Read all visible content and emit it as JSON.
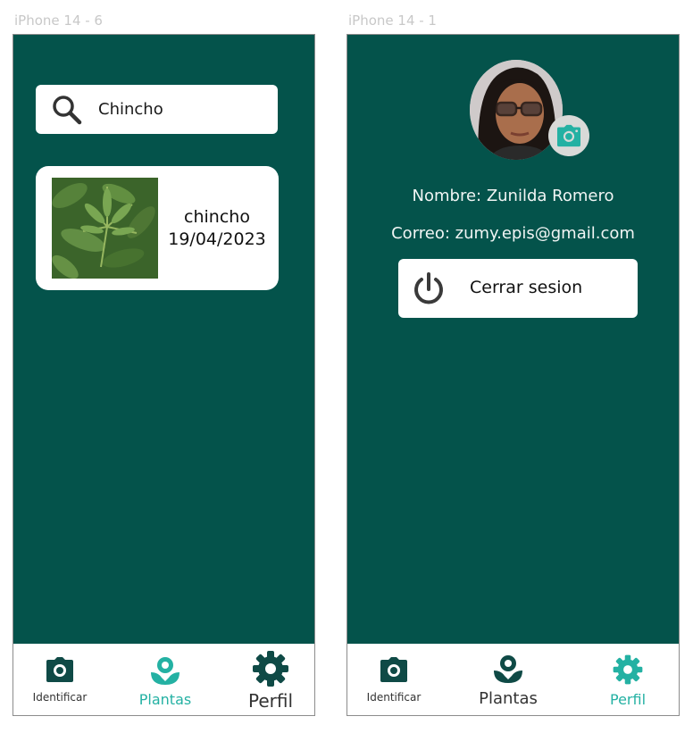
{
  "frames": [
    {
      "label": "iPhone 14 - 6"
    },
    {
      "label": "iPhone 14 - 1"
    }
  ],
  "search": {
    "value": "Chincho"
  },
  "plant_card": {
    "name": "chincho",
    "date": "19/04/2023"
  },
  "profile": {
    "name_line": "Nombre: Zunilda Romero",
    "email_line": "Correo: zumy.epis@gmail.com",
    "logout_label": "Cerrar sesion"
  },
  "nav_left": {
    "identify": "Identificar",
    "plants": "Plantas",
    "profile": "Perfil"
  },
  "nav_right": {
    "identify": "Identificar",
    "plants": "Plantas",
    "profile": "Perfil"
  },
  "colors": {
    "screen_bg": "#04534b",
    "accent": "#24b1a3",
    "icon_dark": "#0f4a46"
  }
}
